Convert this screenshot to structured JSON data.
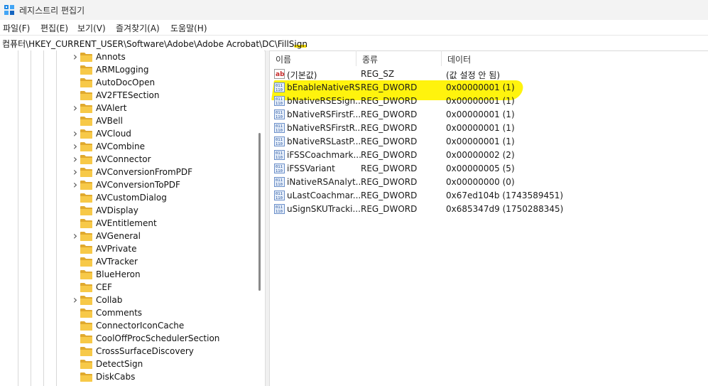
{
  "window": {
    "title": "레지스트리 편집기"
  },
  "menu": [
    "파일(F)",
    "편집(E)",
    "보기(V)",
    "즐겨찾기(A)",
    "도움말(H)"
  ],
  "address": {
    "prefix": "컴퓨터\\HKEY_CURRENT_USER\\Software\\Adobe\\Adobe Acrobat\\DC\\",
    "leaf": "FillSign"
  },
  "tree": {
    "items": [
      {
        "label": "Annots",
        "expandable": true
      },
      {
        "label": "ARMLogging",
        "expandable": false
      },
      {
        "label": "AutoDocOpen",
        "expandable": false
      },
      {
        "label": "AV2FTESection",
        "expandable": false
      },
      {
        "label": "AVAlert",
        "expandable": true
      },
      {
        "label": "AVBell",
        "expandable": false
      },
      {
        "label": "AVCloud",
        "expandable": true
      },
      {
        "label": "AVCombine",
        "expandable": true
      },
      {
        "label": "AVConnector",
        "expandable": true
      },
      {
        "label": "AVConversionFromPDF",
        "expandable": true
      },
      {
        "label": "AVConversionToPDF",
        "expandable": true
      },
      {
        "label": "AVCustomDialog",
        "expandable": false
      },
      {
        "label": "AVDisplay",
        "expandable": false
      },
      {
        "label": "AVEntitlement",
        "expandable": false
      },
      {
        "label": "AVGeneral",
        "expandable": true
      },
      {
        "label": "AVPrivate",
        "expandable": false
      },
      {
        "label": "AVTracker",
        "expandable": false
      },
      {
        "label": "BlueHeron",
        "expandable": false
      },
      {
        "label": "CEF",
        "expandable": false
      },
      {
        "label": "Collab",
        "expandable": true
      },
      {
        "label": "Comments",
        "expandable": false
      },
      {
        "label": "ConnectorIconCache",
        "expandable": false
      },
      {
        "label": "CoolOffProcSchedulerSection",
        "expandable": false
      },
      {
        "label": "CrossSurfaceDiscovery",
        "expandable": false
      },
      {
        "label": "DetectSign",
        "expandable": false
      },
      {
        "label": "DiskCabs",
        "expandable": false
      }
    ]
  },
  "values": {
    "headers": {
      "name": "이름",
      "type": "종류",
      "data": "데이터"
    },
    "rows": [
      {
        "icon": "string-icon",
        "name": "(기본값)",
        "type": "REG_SZ",
        "data": "(값 설정 안 됨)"
      },
      {
        "icon": "binary-icon",
        "name": "bEnableNativeRS",
        "type": "REG_DWORD",
        "data": "0x00000001 (1)",
        "highlighted": true
      },
      {
        "icon": "binary-icon",
        "name": "bNativeRSESign...",
        "type": "REG_DWORD",
        "data": "0x00000001 (1)"
      },
      {
        "icon": "binary-icon",
        "name": "bNativeRSFirstF...",
        "type": "REG_DWORD",
        "data": "0x00000001 (1)"
      },
      {
        "icon": "binary-icon",
        "name": "bNativeRSFirstR...",
        "type": "REG_DWORD",
        "data": "0x00000001 (1)"
      },
      {
        "icon": "binary-icon",
        "name": "bNativeRSLastP...",
        "type": "REG_DWORD",
        "data": "0x00000001 (1)"
      },
      {
        "icon": "binary-icon",
        "name": "iFSSCoachmark...",
        "type": "REG_DWORD",
        "data": "0x00000002 (2)"
      },
      {
        "icon": "binary-icon",
        "name": "iFSSVariant",
        "type": "REG_DWORD",
        "data": "0x00000005 (5)"
      },
      {
        "icon": "binary-icon",
        "name": "iNativeRSAnalyt...",
        "type": "REG_DWORD",
        "data": "0x00000000 (0)"
      },
      {
        "icon": "binary-icon",
        "name": "uLastCoachmar...",
        "type": "REG_DWORD",
        "data": "0x67ed104b (1743589451)"
      },
      {
        "icon": "binary-icon",
        "name": "uSignSKUTracki...",
        "type": "REG_DWORD",
        "data": "0x685347d9 (1750288345)"
      }
    ]
  },
  "colors": {
    "highlight": "#fff200",
    "folder": "#f7c948",
    "folder_dark": "#e0a92e"
  }
}
